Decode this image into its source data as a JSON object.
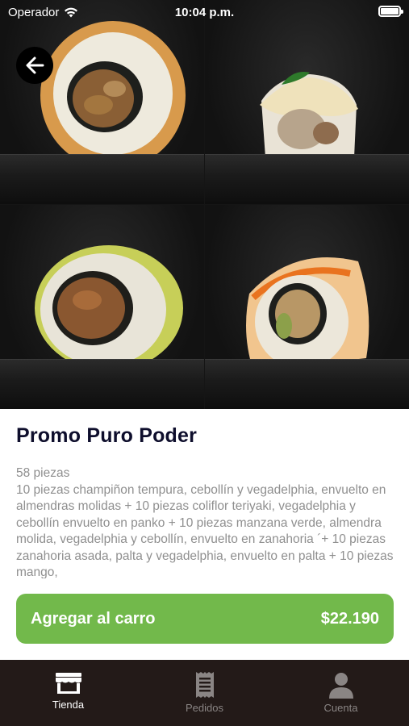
{
  "status_bar": {
    "carrier": "Operador",
    "time": "10:04 p.m.",
    "battery_level": 1.0
  },
  "hero": {
    "image_description_icons": [
      "sushi-roll-tempura",
      "sushi-roll-sauce",
      "sushi-roll-avocado",
      "sushi-roll-carrot"
    ],
    "back_icon": "arrow-left-icon"
  },
  "product": {
    "title": "Promo Puro Poder",
    "pieces": "58 piezas",
    "description": "10 piezas champiñon tempura, cebollín y vegadelphia, envuelto en almendras molidas + 10 piezas coliflor teriyaki, vegadelphia y cebollín envuelto en panko + 10 piezas manzana verde, almendra molida, vegadelphia y cebollín, envuelto en zanahoria ´+ 10 piezas zanahoria asada, palta y vegadelphia, envuelto en palta + 10 piezas mango,"
  },
  "cart_button": {
    "label": "Agregar al carro",
    "price": "$22.190",
    "color": "#72b94b"
  },
  "tabbar": {
    "tabs": [
      {
        "label": "Tienda",
        "icon": "store-icon",
        "active": true
      },
      {
        "label": "Pedidos",
        "icon": "receipt-icon",
        "active": false
      },
      {
        "label": "Cuenta",
        "icon": "person-icon",
        "active": false
      }
    ]
  }
}
